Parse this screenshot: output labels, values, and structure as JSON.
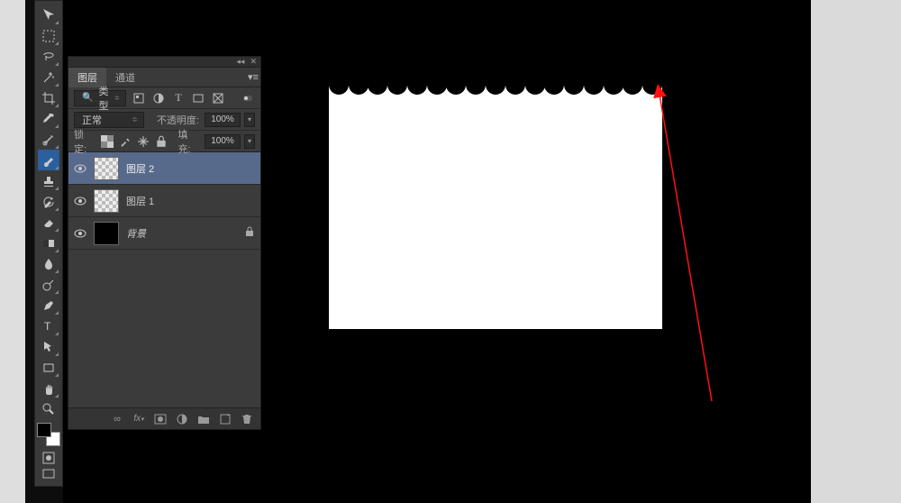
{
  "panel": {
    "tabs": {
      "layers": "图层",
      "channels": "通道"
    },
    "type_label": "类型",
    "blend_mode": "正常",
    "opacity_label": "不透明度:",
    "opacity_value": "100%",
    "lock_label": "锁定:",
    "fill_label": "填充:",
    "fill_value": "100%"
  },
  "layers": [
    {
      "name": "图层 2",
      "thumb": "checker",
      "selected": true,
      "locked": false
    },
    {
      "name": "图层 1",
      "thumb": "checker",
      "selected": false,
      "locked": false
    },
    {
      "name": "背景",
      "thumb": "black",
      "selected": false,
      "locked": true
    }
  ],
  "tools": [
    "move",
    "marquee",
    "lasso",
    "magic-wand",
    "crop",
    "eyedropper",
    "healing",
    "brush",
    "stamp",
    "history-brush",
    "eraser",
    "gradient",
    "blur",
    "dodge",
    "pen",
    "type",
    "path-select",
    "rectangle",
    "hand",
    "zoom"
  ],
  "icons": {
    "search": "⚲",
    "eye": "👁",
    "lock": "🔒",
    "link": "🔗",
    "fx": "fx.",
    "mask": "◐",
    "folder": "📁",
    "new": "🗎",
    "trash": "🗑",
    "adjust": "◑"
  }
}
